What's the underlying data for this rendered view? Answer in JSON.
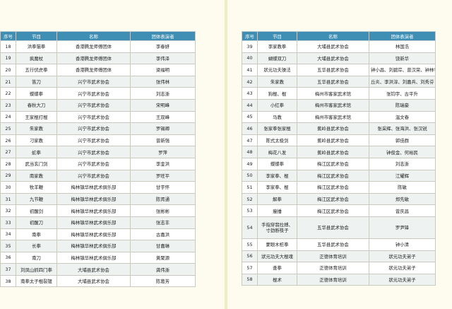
{
  "headers": {
    "idx": "序号",
    "item": "节目",
    "name": "名称",
    "performer": "团体表演者"
  },
  "left_rows": [
    {
      "idx": "18",
      "item": "洪拳猫拳",
      "name": "香港腾龙师傅团体",
      "performer": "李春妍"
    },
    {
      "idx": "19",
      "item": "疯魔杖",
      "name": "香港腾龙师傅团体",
      "performer": "李伟泽"
    },
    {
      "idx": "20",
      "item": "五行伏虎拳",
      "name": "香港腾龙师傅团体",
      "performer": "梁福明"
    },
    {
      "idx": "21",
      "item": "笛刀",
      "name": "兴宁市武术协会",
      "performer": "张伟林"
    },
    {
      "idx": "22",
      "item": "蝶蝶拳",
      "name": "兴宁市武术协会",
      "performer": "刘志浙"
    },
    {
      "idx": "23",
      "item": "春秋大刀",
      "name": "兴宁市武术协会",
      "performer": "宋明峰"
    },
    {
      "idx": "24",
      "item": "王家棍打棍",
      "name": "兴宁市武术协会",
      "performer": "王双峰"
    },
    {
      "idx": "25",
      "item": "朱家教",
      "name": "兴宁市武术协会",
      "performer": "罗锡卿"
    },
    {
      "idx": "26",
      "item": "刁家教",
      "name": "兴宁市武术协会",
      "performer": "曾新强"
    },
    {
      "idx": "27",
      "item": "蛇拳",
      "name": "兴宁市武术协会",
      "performer": "罗萍"
    },
    {
      "idx": "28",
      "item": "武当玄门剑",
      "name": "兴宁市武术协会",
      "performer": "李金洪"
    },
    {
      "idx": "29",
      "item": "南家教",
      "name": "兴宁市武术协会",
      "performer": "罗旺平"
    },
    {
      "idx": "30",
      "item": "牧羊鞭",
      "name": "梅林镇华林武术俱乐部",
      "performer": "甘宇怀"
    },
    {
      "idx": "31",
      "item": "九节鞭",
      "name": "梅林镇华林武术俱乐部",
      "performer": "陈胥通"
    },
    {
      "idx": "32",
      "item": "初醒剑",
      "name": "梅林镇华林武术俱乐部",
      "performer": "张彬彬"
    },
    {
      "idx": "33",
      "item": "初醒刀",
      "name": "梅林镇华林武术俱乐部",
      "performer": "张志丰"
    },
    {
      "idx": "34",
      "item": "南拳",
      "name": "梅林镇华林武术俱乐部",
      "performer": "古嘉洪"
    },
    {
      "idx": "35",
      "item": "长拳",
      "name": "梅林镇华林武术俱乐部",
      "performer": "甘嘉琳"
    },
    {
      "idx": "36",
      "item": "南刀",
      "name": "梅林镇华林武术俱乐部",
      "performer": "黄聚源"
    },
    {
      "idx": "37",
      "item": "刘凤山抓四门拳",
      "name": "大埔县武术协会",
      "performer": "龚伟浙"
    },
    {
      "idx": "38",
      "item": "南拳太子棍裂镀",
      "name": "大埔县武术协会",
      "performer": "陈葛芳"
    }
  ],
  "right_rows": [
    {
      "idx": "39",
      "item": "李家教拳",
      "name": "大埔县武术协会",
      "performer": "林国浩"
    },
    {
      "idx": "40",
      "item": "蝴蝶双刀",
      "name": "大埔县武术协会",
      "performer": "饶新华"
    },
    {
      "idx": "41",
      "item": "狀元功夫操法",
      "name": "五华县武术协会",
      "performer": "钟小昌、刘碧岸、曾汉荣、钟林睿"
    },
    {
      "idx": "42",
      "item": "朱家教",
      "name": "五华县武术协会",
      "performer": "丘炎、李洪淳、刘嘉兵、刘秀芬"
    },
    {
      "idx": "43",
      "item": "狗棍、棍",
      "name": "梅州市客家武术馆",
      "performer": "张钧宇、古平升"
    },
    {
      "idx": "44",
      "item": "小红拳",
      "name": "梅州市客家武术馆",
      "performer": "陈瑞豪"
    },
    {
      "idx": "45",
      "item": "马教",
      "name": "梅州市客家武术馆",
      "performer": "温文春"
    },
    {
      "idx": "46",
      "item": "张家拳张家棍",
      "name": "蕉岭县武术协会",
      "performer": "张采辉、张海洪、张汉锐"
    },
    {
      "idx": "47",
      "item": "陈式太极剑",
      "name": "蕉岭县武术协会",
      "performer": "郭佳群"
    },
    {
      "idx": "48",
      "item": "梅花八发",
      "name": "蕉岭县武术协会",
      "performer": "钟俊金、何裕民"
    },
    {
      "idx": "49",
      "item": "蝶蝶拳",
      "name": "梅江区武术协会",
      "performer": "刘志浙"
    },
    {
      "idx": "50",
      "item": "李家拳、棍",
      "name": "梅江区武术协会",
      "performer": "江耀辉"
    },
    {
      "idx": "51",
      "item": "李家拳、棍",
      "name": "梅江区武术协会",
      "performer": "陈敏"
    },
    {
      "idx": "52",
      "item": "解拳",
      "name": "梅江区武术协会",
      "performer": "郑先敏"
    },
    {
      "idx": "53",
      "item": "瘦捶",
      "name": "梅江区武术协会",
      "performer": "曾庆昌"
    },
    {
      "idx": "54",
      "item": "手指穿翡拉搏、寸劲断筷子",
      "name": "五华县武术协会",
      "performer": "罗尹锋",
      "tall": true
    },
    {
      "idx": "55",
      "item": "蒙眼木桩拳",
      "name": "五华县武术协会",
      "performer": "钟小清"
    },
    {
      "idx": "56",
      "item": "狀元功夫大棍魂",
      "name": "正德体育培训",
      "performer": "狀元功夫弟子"
    },
    {
      "idx": "57",
      "item": "查拳",
      "name": "正德体育培训",
      "performer": "狀元功夫弟子"
    },
    {
      "idx": "58",
      "item": "棍术",
      "name": "正德体育培训",
      "performer": "狀元功夫弟子"
    }
  ],
  "colors": {
    "header_bg": "#3f8fb5",
    "page_bg": "#f7f5d7",
    "row_alt": "#eef2f1"
  }
}
